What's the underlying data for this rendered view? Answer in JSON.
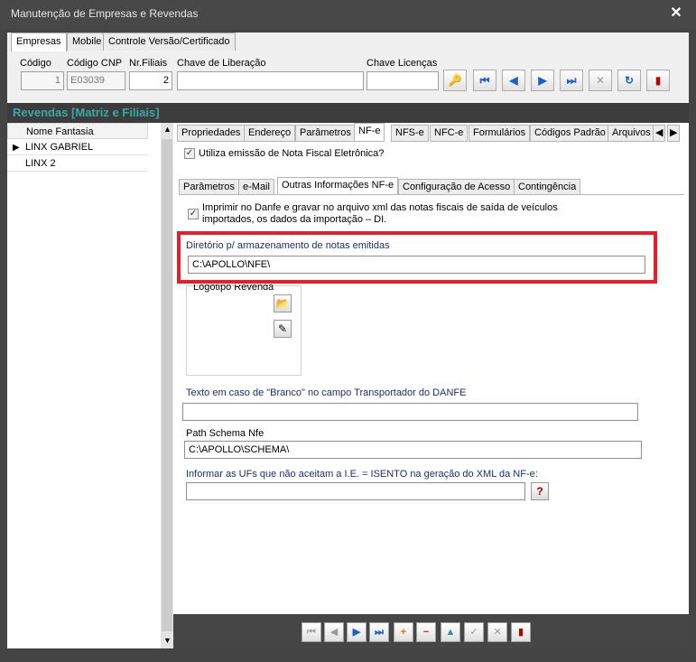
{
  "window": {
    "title": "Manutenção de Empresas e Revendas",
    "close_label": "✕"
  },
  "top_tabs": [
    "Empresas",
    "Mobile",
    "Controle Versão/Certificado"
  ],
  "top_fields": {
    "codigo": {
      "label": "Código",
      "value": "1"
    },
    "codigo_cnp": {
      "label": "Código CNP",
      "value": "E03039"
    },
    "nr_filiais": {
      "label": "Nr.Filiais",
      "value": "2"
    },
    "chave_liberacao": {
      "label": "Chave de Liberação",
      "value": ""
    },
    "chave_licencas": {
      "label": "Chave Licenças",
      "value": ""
    }
  },
  "revendas_header": "Revendas [Matriz e Filiais]",
  "list": {
    "header": "Nome Fantasia",
    "rows": [
      "LINX GABRIEL",
      "LINX 2"
    ]
  },
  "section_tabs": [
    "Propriedades",
    "Endereço",
    "Parâmetros",
    "NF-e",
    "NFS-e",
    "NFC-e",
    "Formulários",
    "Códigos Padrão",
    "Arquivos"
  ],
  "nfe_checkbox_label": "Utiliza emissão de Nota Fiscal Eletrônica?",
  "inner_tabs": [
    "Parâmetros",
    "e-Mail",
    "Outras Informações NF-e",
    "Configuração de Acesso",
    "Contingência"
  ],
  "imprimir_label_line1": "Imprimir no Danfe e gravar no arquivo xml das notas fiscais de saída de veículos",
  "imprimir_label_line2": "importados, os dados da importação – DI.",
  "diretorio": {
    "label": "Diretório p/ armazenamento de notas emitidas",
    "value": "C:\\APOLLO\\NFE\\"
  },
  "logotipo_label": "Logotipo Revenda",
  "texto_branco": {
    "label": "Texto em caso de \"Branco\" no campo Transportador do DANFE",
    "value": ""
  },
  "path_schema": {
    "label": "Path Schema Nfe",
    "value": "C:\\APOLLO\\SCHEMA\\"
  },
  "ufs_isento": {
    "label": "Informar as UFs que não aceitam a I.E. = ISENTO na geração do XML da NF-e:",
    "value": ""
  },
  "colors": {
    "accent_teal": "#3aa8a4",
    "highlight_red": "#e0202a",
    "nav_blue": "#1d5fc9"
  }
}
